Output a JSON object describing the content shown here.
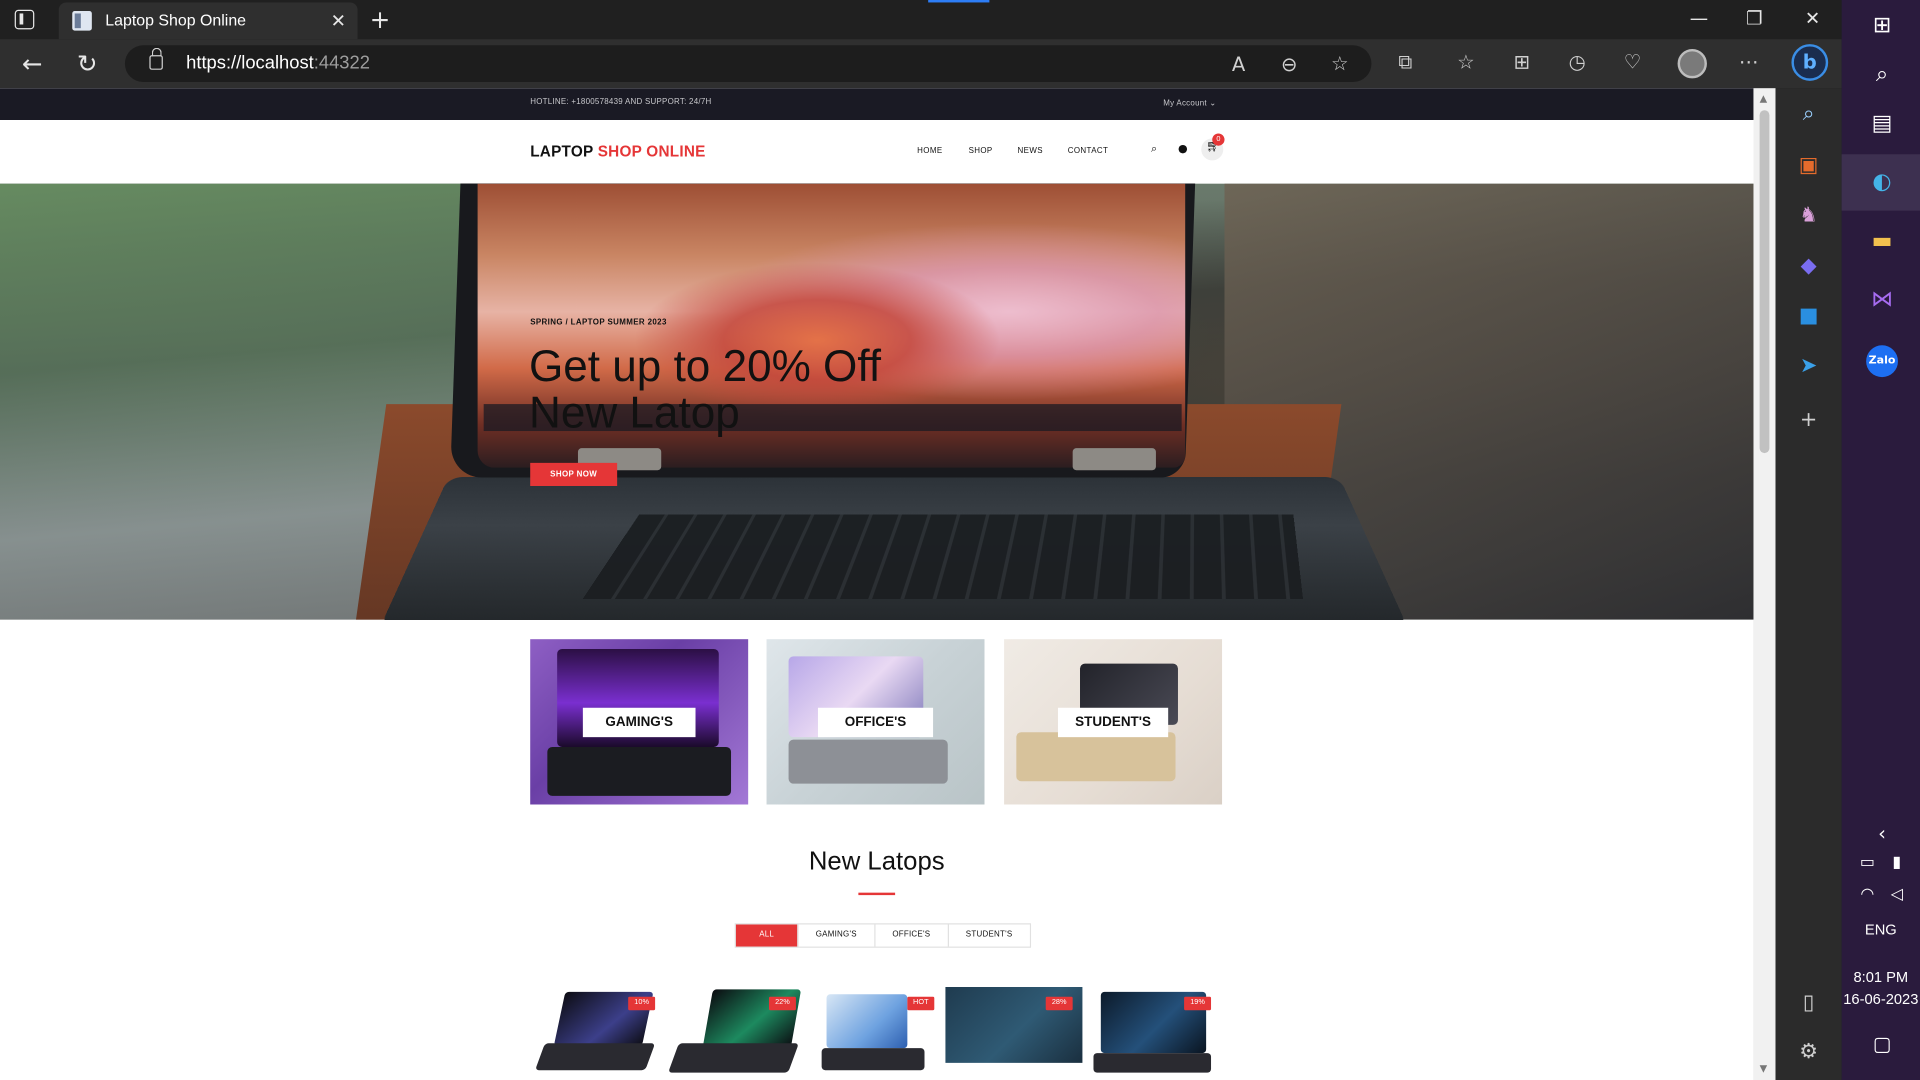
{
  "browser": {
    "tab_title": "Laptop Shop Online",
    "url_host": "https://localhost",
    "url_port": ":44322",
    "controls": {
      "minimize": "—",
      "restore": "❐",
      "close": "✕",
      "tab_close": "✕",
      "new_tab": "+"
    }
  },
  "site": {
    "topbar": {
      "hotline": "HOTLINE: +1800578439 AND SUPPORT: 24/7H",
      "account": "My Account"
    },
    "logo": {
      "part1": "LAPTOP ",
      "part2": "SHOP ONLINE"
    },
    "nav": [
      "HOME",
      "SHOP",
      "NEWS",
      "CONTACT"
    ],
    "cart_count": "0",
    "hero": {
      "subtitle": "SPRING / LAPTOP SUMMER 2023",
      "title_line1": "Get up to 20% Off",
      "title_line2": "New Latop",
      "button": "SHOP NOW"
    },
    "categories": [
      "GAMING'S",
      "OFFICE'S",
      "STUDENT'S"
    ],
    "section_title": "New Latops",
    "filters": [
      "ALL",
      "GAMING'S",
      "OFFICE'S",
      "STUDENT'S"
    ],
    "products": [
      {
        "badge": "10%"
      },
      {
        "badge": "22%"
      },
      {
        "badge": "HOT"
      },
      {
        "badge": "28%"
      },
      {
        "badge": "19%"
      }
    ],
    "colors": {
      "accent": "#e53637",
      "topbar": "#1a1a24"
    }
  },
  "taskbar": {
    "language": "ENG",
    "time": "8:01 PM",
    "date": "16-06-2023",
    "zalo_label": "Zalo"
  }
}
